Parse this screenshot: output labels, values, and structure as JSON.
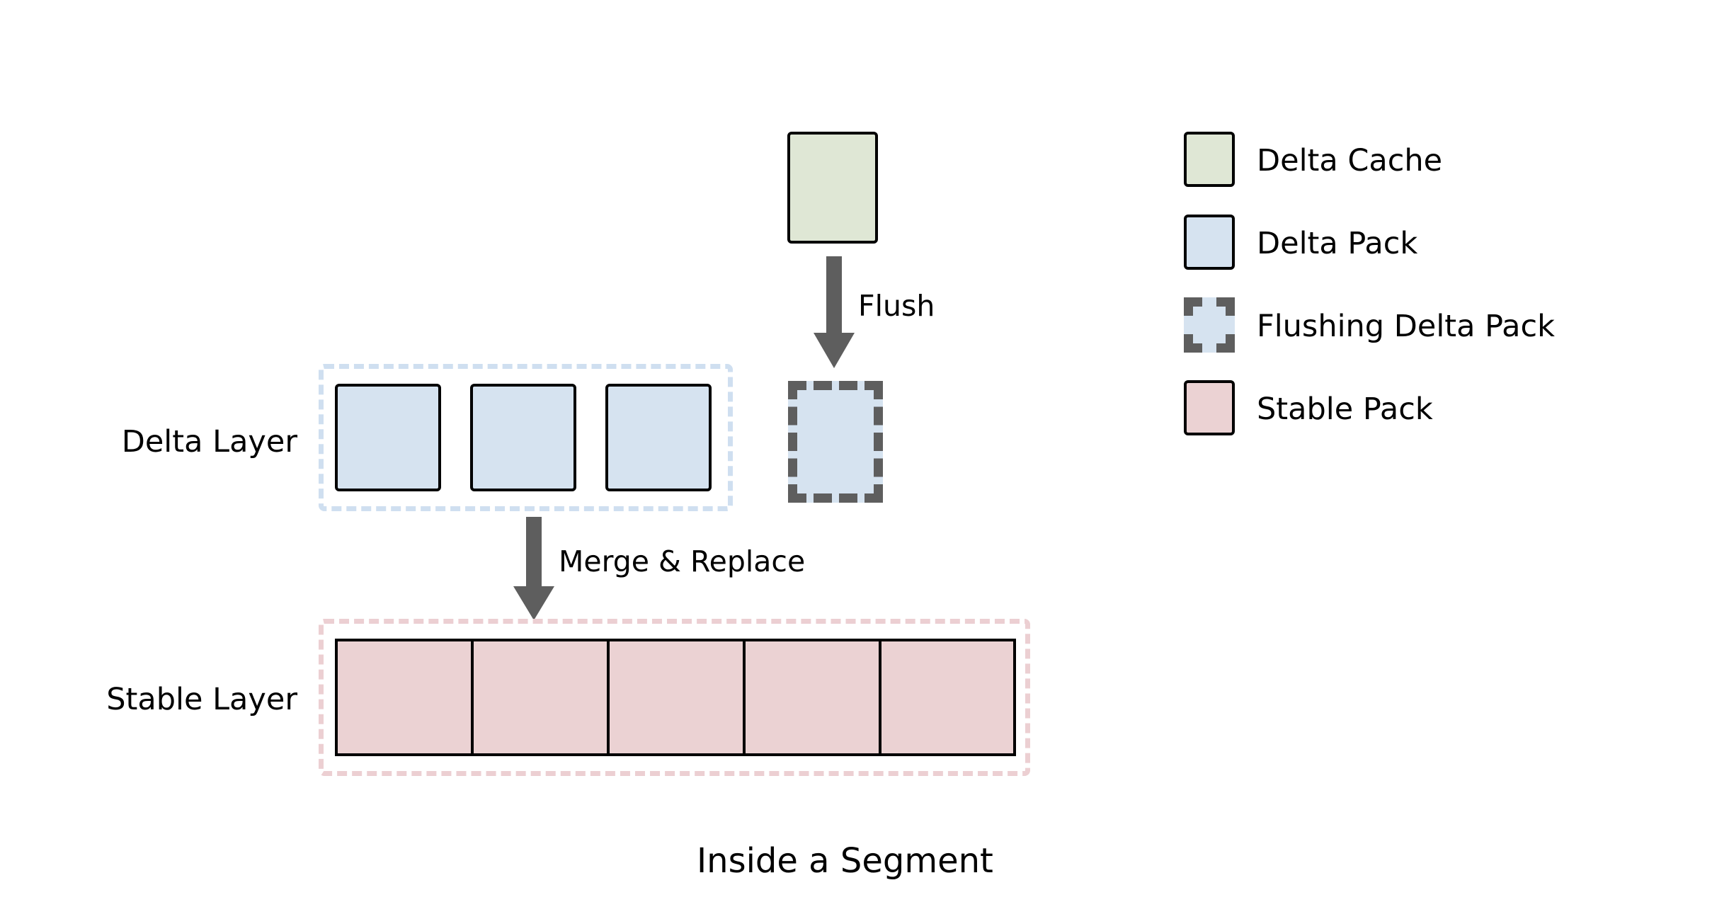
{
  "caption": "Inside a Segment",
  "layers": {
    "delta_label": "Delta Layer",
    "stable_label": "Stable Layer"
  },
  "arrows": {
    "flush_label": "Flush",
    "merge_label": "Merge & Replace",
    "color": "#5e5e5e"
  },
  "delta_cache": {
    "name": "Delta Cache",
    "color": "#dfe7d5"
  },
  "delta_layer": {
    "pack_color": "#d6e3f0",
    "group_border_color": "#cfdff0",
    "packs": [
      {
        "id": "delta-pack-1"
      },
      {
        "id": "delta-pack-2"
      },
      {
        "id": "delta-pack-3"
      }
    ]
  },
  "flushing_pack": {
    "name": "Flushing Delta Pack",
    "fill_color": "#d6e3f0",
    "border_color": "#5e5e5e"
  },
  "stable_layer": {
    "pack_color": "#ebd2d3",
    "group_border_color": "#eccfd2",
    "packs": [
      {
        "id": "stable-pack-1"
      },
      {
        "id": "stable-pack-2"
      },
      {
        "id": "stable-pack-3"
      },
      {
        "id": "stable-pack-4"
      },
      {
        "id": "stable-pack-5"
      }
    ]
  },
  "legend": {
    "items": [
      {
        "label": "Delta Cache",
        "color": "#dfe7d5",
        "style": "solid"
      },
      {
        "label": "Delta Pack",
        "color": "#d6e3f0",
        "style": "solid"
      },
      {
        "label": "Flushing Delta Pack",
        "color": "#d6e3f0",
        "style": "dashed"
      },
      {
        "label": "Stable Pack",
        "color": "#ebd2d3",
        "style": "solid"
      }
    ]
  }
}
